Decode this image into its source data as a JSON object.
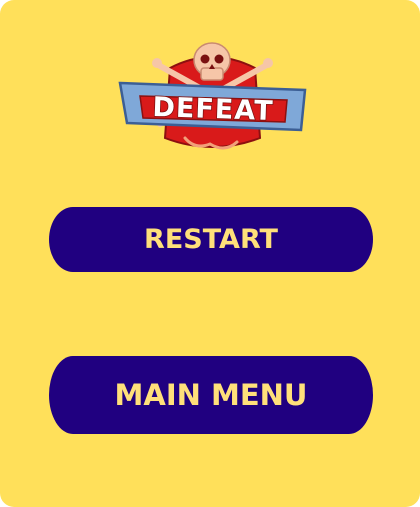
{
  "screen": {
    "background": "#FFE05A",
    "accent": "#200080",
    "button_text_color": "#FFE07A"
  },
  "banner": {
    "text": "DEFEAT",
    "icon": "skull-crossbones-icon",
    "colors": {
      "plank": "#7FA8D8",
      "plaque": "#E02020",
      "skull": "#F6C6A8"
    }
  },
  "buttons": {
    "restart_label": "RESTART",
    "main_menu_label": "MAIN MENU"
  }
}
